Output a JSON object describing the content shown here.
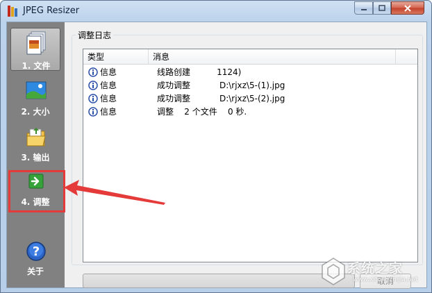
{
  "window": {
    "title": "JPEG Resizer"
  },
  "sidebar": {
    "items": [
      {
        "label": "1. 文件"
      },
      {
        "label": "2. 大小"
      },
      {
        "label": "3. 输出"
      },
      {
        "label": "4. 调整"
      },
      {
        "label": "关于"
      }
    ]
  },
  "panel": {
    "title": "调整日志"
  },
  "log": {
    "columns": [
      "类型",
      "消息"
    ],
    "rows": [
      {
        "type": "信息",
        "message": "线路创建          1124)"
      },
      {
        "type": "信息",
        "message": "成功调整           D:\\rjxz\\5-(1).jpg"
      },
      {
        "type": "信息",
        "message": "成功调整           D:\\rjxz\\5-(2).jpg"
      },
      {
        "type": "信息",
        "message": "调整    2 个文件    0 秒."
      }
    ]
  },
  "buttons": {
    "cancel": "取消"
  },
  "watermark": {
    "text": "系统之家",
    "url": "www.xitongzhijia.net"
  },
  "colors": {
    "sidebar": "#818181",
    "highlight": "#e53a3a",
    "info_icon": "#2a4fa8"
  }
}
